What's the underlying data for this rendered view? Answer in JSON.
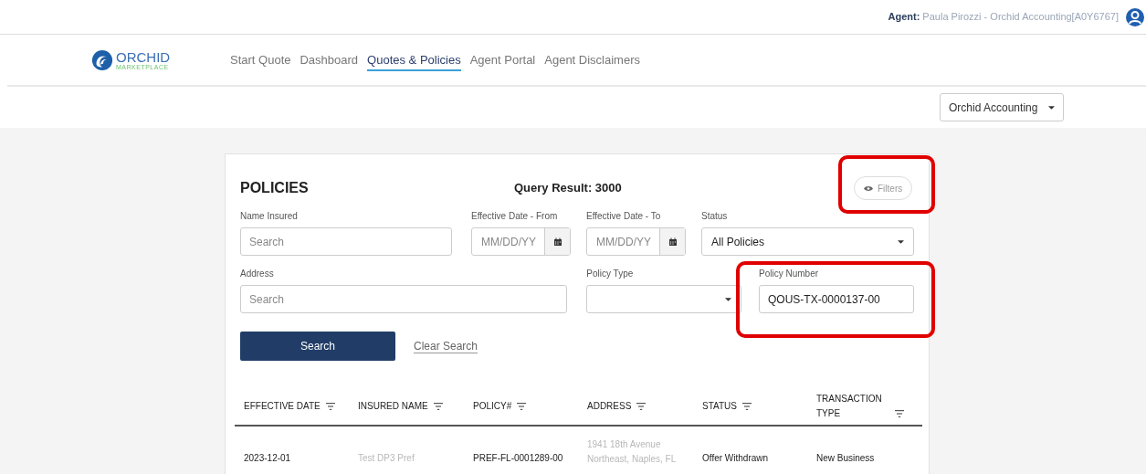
{
  "header": {
    "agent_label": "Agent:",
    "agent_name": "Paula Pirozzi - Orchid Accounting[A0Y6767]"
  },
  "logo": {
    "name": "ORCHID",
    "tagline": "MARKETPLACE"
  },
  "nav": [
    {
      "label": "Start Quote",
      "selected": false
    },
    {
      "label": "Dashboard",
      "selected": false
    },
    {
      "label": "Quotes & Policies",
      "selected": true
    },
    {
      "label": "Agent Portal",
      "selected": false
    },
    {
      "label": "Agent Disclaimers",
      "selected": false
    }
  ],
  "agency_select": {
    "value": "Orchid Accounting"
  },
  "panel": {
    "title": "POLICIES",
    "query_result": "Query Result: 3000",
    "filters_button": "Filters",
    "fields_row_1": [
      {
        "kind": "text",
        "label": "Name Insured",
        "placeholder": "Search"
      },
      {
        "kind": "date",
        "label": "Effective Date - From",
        "placeholder": "MM/DD/YY"
      },
      {
        "kind": "date",
        "label": "Effective Date - To",
        "placeholder": "MM/DD/YY"
      },
      {
        "kind": "select",
        "label": "Status",
        "value": "All Policies"
      }
    ],
    "fields_row_2": [
      {
        "kind": "text",
        "label": "Address",
        "placeholder": "Search"
      },
      {
        "kind": "select",
        "label": "Policy Type"
      },
      {
        "kind": "text",
        "label": "Policy Number",
        "value": "QOUS-TX-0000137-00"
      }
    ],
    "search_button": "Search",
    "clear_button": "Clear Search"
  },
  "table": {
    "columns": [
      "EFFECTIVE DATE",
      "INSURED NAME",
      "POLICY#",
      "ADDRESS",
      "STATUS",
      "TRANSACTION TYPE"
    ],
    "rows": [
      {
        "cells": [
          "2023-12-01",
          "Test DP3 Pref",
          "PREF-FL-0001289-00",
          "1941 18th Avenue Northeast, Naples, FL",
          "Offer Withdrawn",
          "New Business"
        ]
      }
    ]
  },
  "highlights": [
    {
      "kind": "ring"
    },
    {
      "kind": "ring"
    }
  ]
}
